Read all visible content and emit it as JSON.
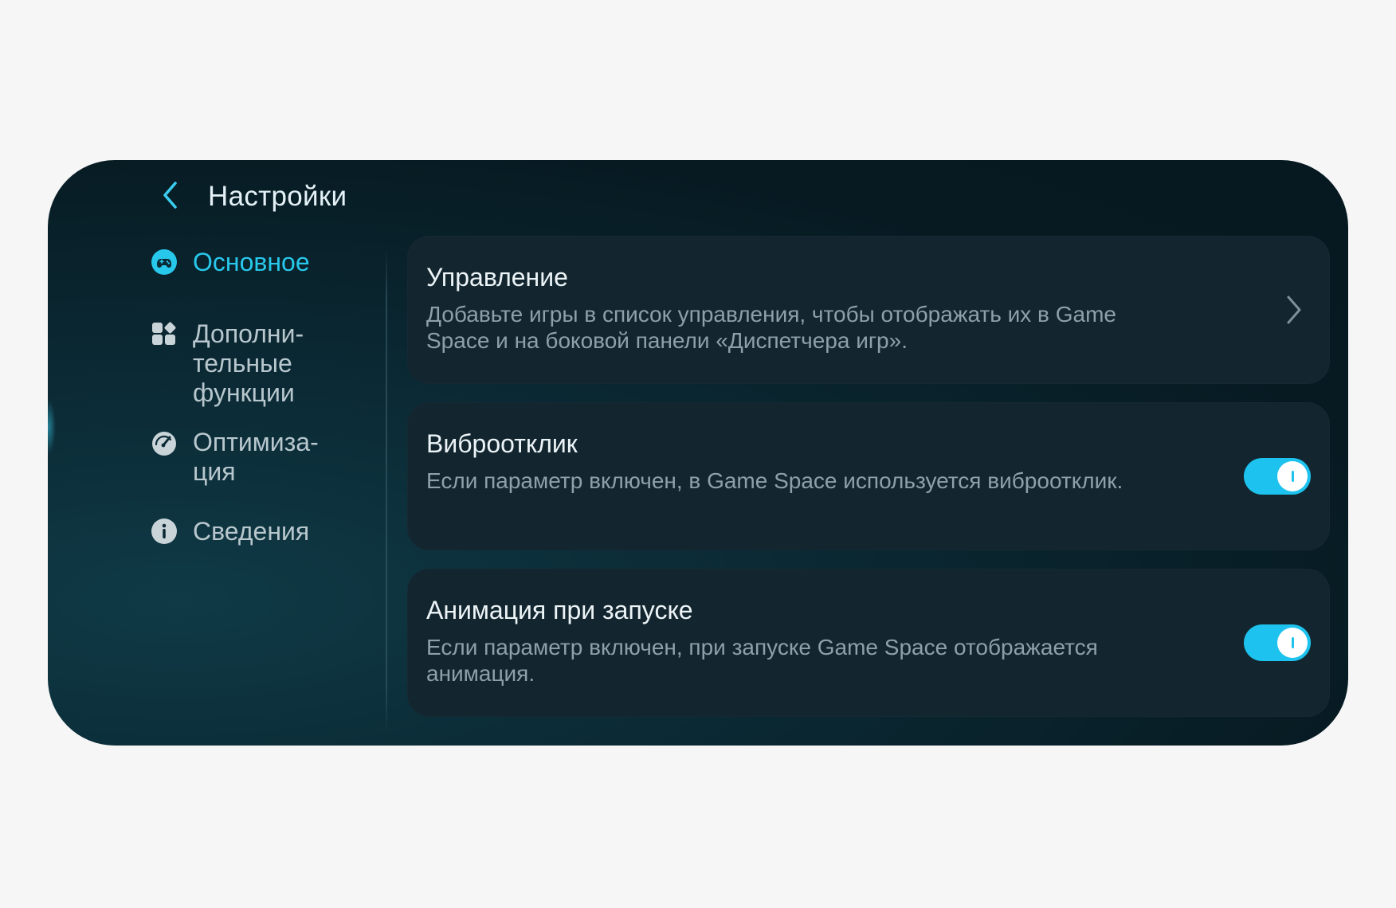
{
  "header": {
    "title": "Настройки",
    "back_icon": "chevron-left-icon"
  },
  "sidebar": {
    "items": [
      {
        "label": "Основное",
        "icon": "gamepad-icon",
        "active": true
      },
      {
        "label": "Дополни-\nтельные\nфункции",
        "icon": "apps-grid-icon",
        "active": false
      },
      {
        "label": "Оптимиза-\nция",
        "icon": "speedometer-icon",
        "active": false
      },
      {
        "label": "Сведения",
        "icon": "info-icon",
        "active": false
      }
    ]
  },
  "cards": [
    {
      "title": "Управление",
      "description": "Добавьте игры в список управления, чтобы отображать их в Game Space и на боковой панели «Диспетчера игр».",
      "control": "chevron-right-icon"
    },
    {
      "title": "Виброотклик",
      "description": "Если параметр включен, в Game Space используется виброотклик.",
      "control": "toggle",
      "enabled": true
    },
    {
      "title": "Анимация при запуске",
      "description": "Если параметр включен, при запуске Game Space отображается анимация.",
      "control": "toggle",
      "enabled": true
    }
  ],
  "colors": {
    "accent": "#27c8eb",
    "toggle_on": "#1dc3ee",
    "card_bg": "#13262f",
    "page_bg": "#f6f6f6"
  }
}
